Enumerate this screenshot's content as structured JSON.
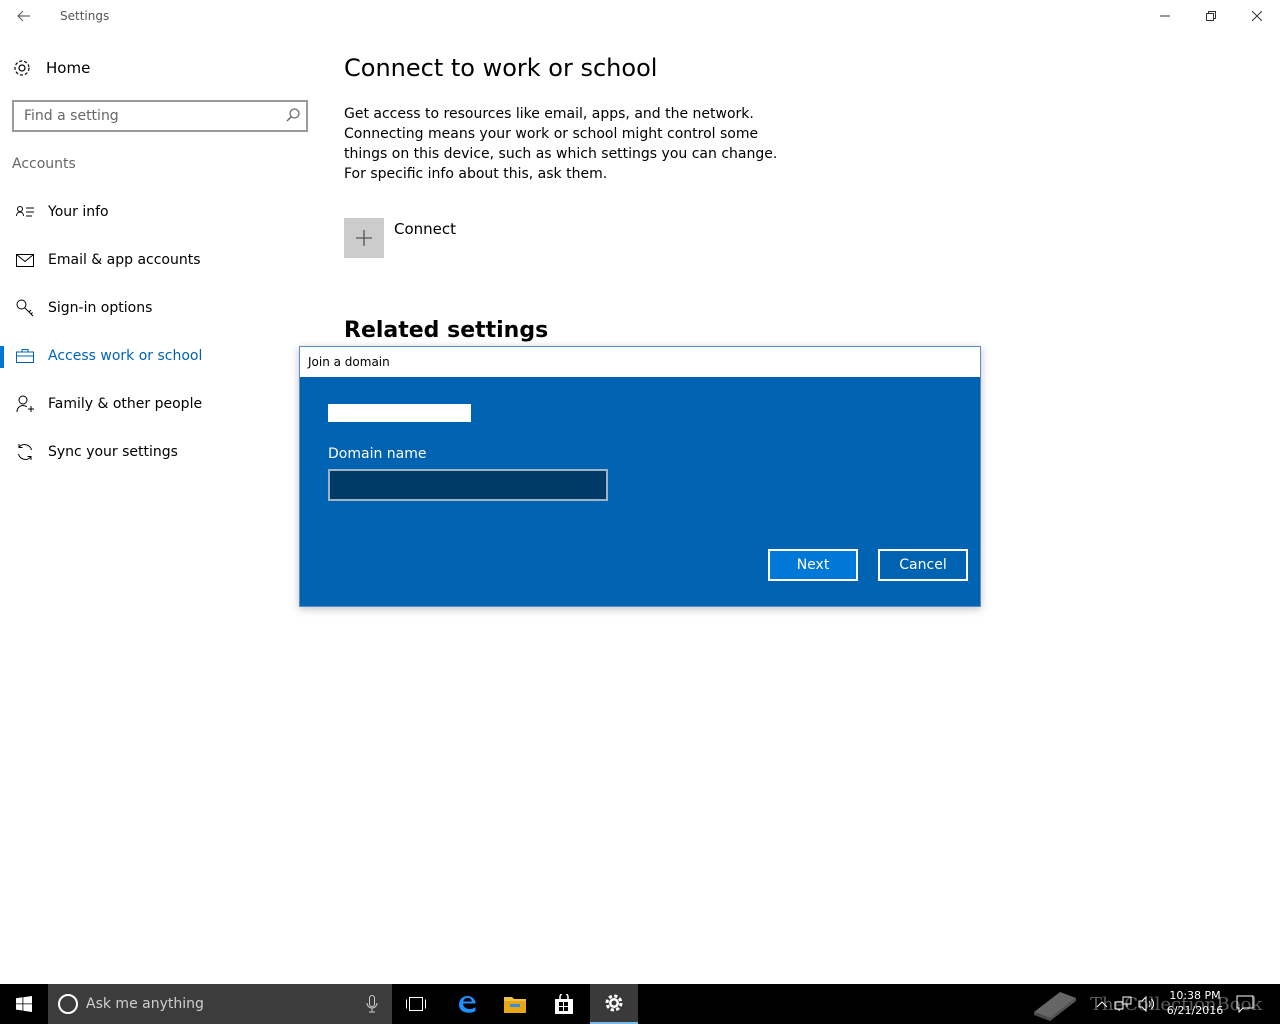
{
  "window": {
    "title": "Settings"
  },
  "sidebar": {
    "home_label": "Home",
    "search_placeholder": "Find a setting",
    "section_label": "Accounts",
    "items": [
      {
        "label": "Your info",
        "icon": "contact-card-icon"
      },
      {
        "label": "Email & app accounts",
        "icon": "mail-icon"
      },
      {
        "label": "Sign-in options",
        "icon": "key-icon"
      },
      {
        "label": "Access work or school",
        "icon": "briefcase-icon",
        "active": true
      },
      {
        "label": "Family & other people",
        "icon": "person-add-icon"
      },
      {
        "label": "Sync your settings",
        "icon": "sync-icon"
      }
    ]
  },
  "main": {
    "title": "Connect to work or school",
    "description": "Get access to resources like email, apps, and the network. Connecting means your work or school might control some things on this device, such as which settings you can change. For specific info about this, ask them.",
    "connect_label": "Connect",
    "related_settings_title": "Related settings"
  },
  "dialog": {
    "title": "Join a domain",
    "domain_label": "Domain name",
    "domain_value": "",
    "next_label": "Next",
    "cancel_label": "Cancel"
  },
  "taskbar": {
    "search_placeholder": "Ask me anything",
    "time": "10:38 PM",
    "date": "6/21/2016",
    "watermark": "TheCollectionBook"
  },
  "colors": {
    "accent": "#0078d7",
    "dialog_bg": "#0063b1",
    "active_nav_text": "#0063b1",
    "taskbar_bg": "#000000"
  }
}
